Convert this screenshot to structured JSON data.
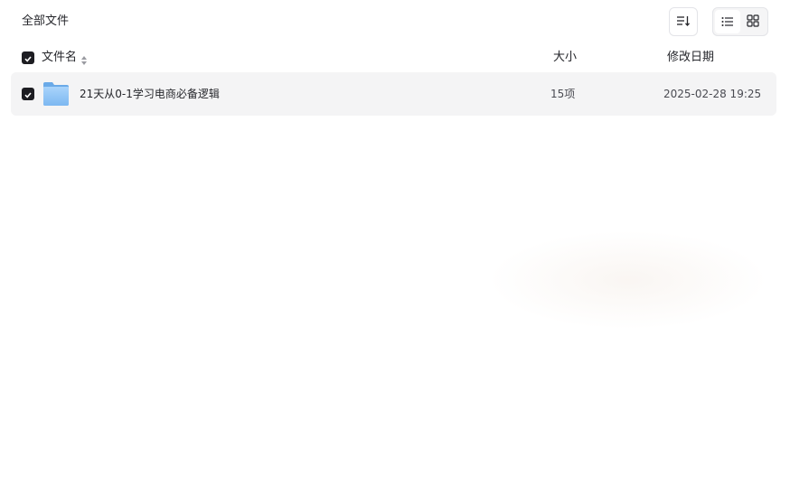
{
  "breadcrumb": {
    "current": "全部文件"
  },
  "toolbar": {
    "sort_icon": "sort-list-icon",
    "view_list_icon": "list-view-icon",
    "view_grid_icon": "grid-view-icon",
    "active_view": "list"
  },
  "table": {
    "columns": {
      "name": "文件名",
      "size": "大小",
      "modified": "修改日期"
    },
    "all_selected": true,
    "rows": [
      {
        "type": "folder",
        "icon": "folder-icon",
        "name": "21天从0-1学习电商必备逻辑",
        "size": "15项",
        "modified": "2025-02-28 19:25",
        "selected": true
      }
    ]
  },
  "colors": {
    "row_bg": "#f4f4f5",
    "checkbox": "#1d1d22",
    "folder": "#8cc4f6",
    "text": "#25262b"
  }
}
